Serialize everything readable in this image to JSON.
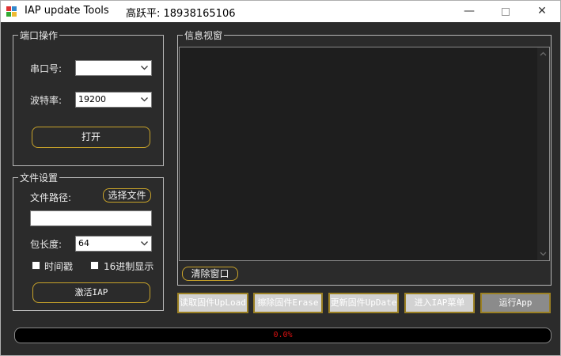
{
  "window": {
    "title": "IAP update Tools",
    "author": "高跃平: 18938165106",
    "controls": {
      "minimize": "—",
      "close": "✕"
    }
  },
  "port_group": {
    "legend": "端口操作",
    "port_label": "串口号:",
    "port_value": "",
    "baud_label": "波特率:",
    "baud_value": "19200",
    "open_button": "打开"
  },
  "file_group": {
    "legend": "文件设置",
    "path_label": "文件路径:",
    "select_button": "选择文件",
    "path_value": "",
    "packet_label": "包长度:",
    "packet_value": "64",
    "timestamp_label": "时间戳",
    "timestamp_checked": false,
    "hex_label": "16进制显示",
    "hex_checked": false,
    "activate_button": "激活IAP"
  },
  "info_group": {
    "legend": "信息视窗",
    "log_text": "",
    "clear_button": "清除窗口"
  },
  "actions": [
    {
      "label": "读取固件UpLoad"
    },
    {
      "label": "擦除固件Erase"
    },
    {
      "label": "更新固件UpDate"
    },
    {
      "label": "进入IAP菜单"
    },
    {
      "label": "运行App"
    }
  ],
  "progress": {
    "value": 0,
    "text": "0.0%",
    "fill_color": "#33aa33",
    "text_color": "#dd1111"
  },
  "colors": {
    "accent_border": "#c8a32a",
    "background": "#2b2b2b"
  }
}
